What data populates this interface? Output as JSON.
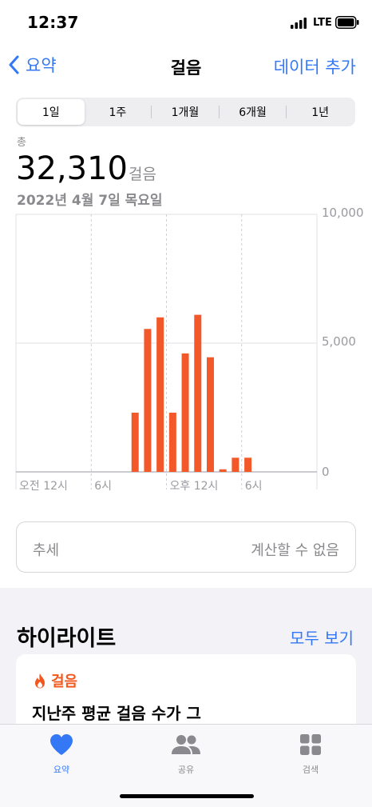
{
  "status_bar": {
    "time": "12:37",
    "network": "LTE"
  },
  "nav": {
    "back_label": "요약",
    "title": "걸음",
    "action_label": "데이터 추가"
  },
  "segments": [
    {
      "label": "1일",
      "selected": true
    },
    {
      "label": "1주",
      "selected": false
    },
    {
      "label": "1개월",
      "selected": false
    },
    {
      "label": "6개월",
      "selected": false
    },
    {
      "label": "1년",
      "selected": false
    }
  ],
  "summary": {
    "label": "총",
    "value": "32,310",
    "unit": "걸음",
    "date": "2022년 4월 7일 목요일"
  },
  "colors": {
    "accent": "#3478f6",
    "bar": "#f2582a",
    "highlight": "#f2581e"
  },
  "chart_data": {
    "type": "bar",
    "categories": [
      "0",
      "1",
      "2",
      "3",
      "4",
      "5",
      "6",
      "7",
      "8",
      "9",
      "10",
      "11",
      "12",
      "13",
      "14",
      "15",
      "16",
      "17",
      "18",
      "19",
      "20",
      "21",
      "22",
      "23"
    ],
    "values": [
      0,
      0,
      0,
      0,
      0,
      0,
      0,
      0,
      0,
      2300,
      5550,
      6000,
      2300,
      4600,
      6100,
      4450,
      100,
      550,
      550,
      0,
      0,
      0,
      0,
      0
    ],
    "xticks": [
      "오전 12시",
      "6시",
      "오후 12시",
      "6시"
    ],
    "yticks": [
      "10,000",
      "5,000",
      "0"
    ],
    "ylim": [
      0,
      10000
    ],
    "grid": true
  },
  "trend": {
    "label": "추세",
    "value": "계산할 수 없음"
  },
  "highlights": {
    "title": "하이라이트",
    "show_all": "모두 보기",
    "card": {
      "category": "걸음",
      "icon": "flame-icon",
      "text": "지난주 평균 걸음 수가 그"
    }
  },
  "tabs": [
    {
      "label": "요약",
      "icon": "heart-icon",
      "active": true
    },
    {
      "label": "공유",
      "icon": "people-icon",
      "active": false
    },
    {
      "label": "검색",
      "icon": "grid-icon",
      "active": false
    }
  ]
}
